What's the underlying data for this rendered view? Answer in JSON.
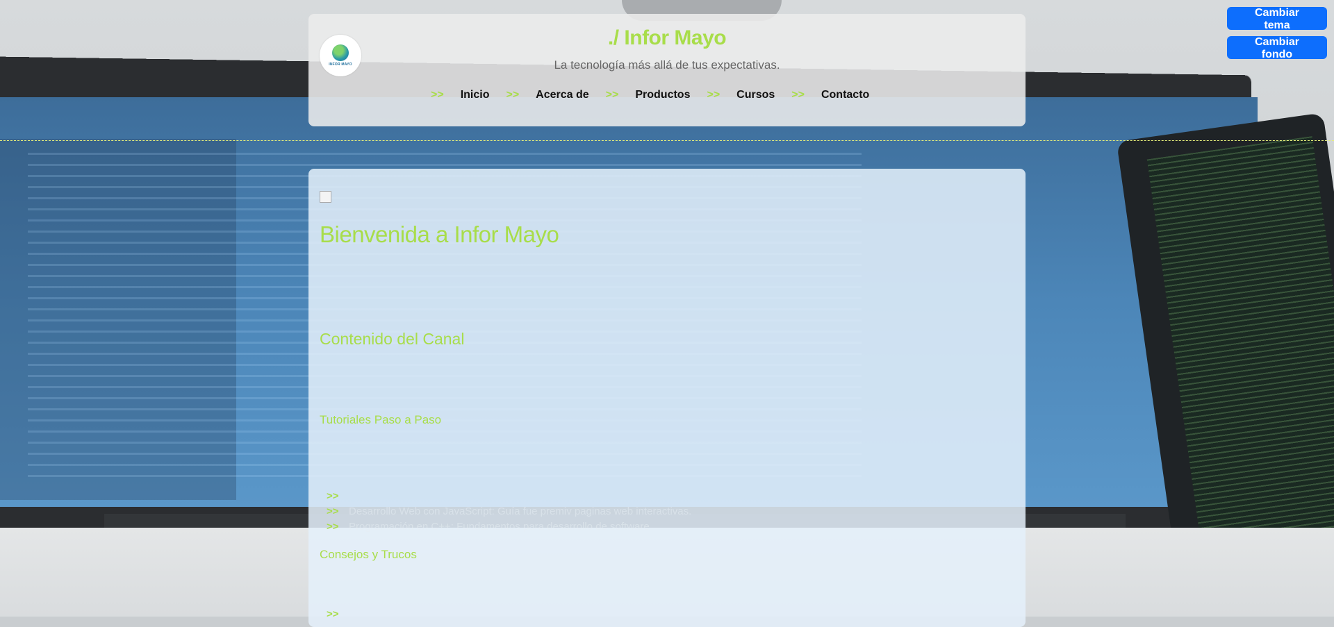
{
  "header": {
    "title": "./ Infor Mayo",
    "tagline": "La tecnología más allá de tus expectativas.",
    "logo": {
      "name": "INFOR MAYO"
    },
    "nav_separator": ">>",
    "nav": [
      {
        "label": "Inicio"
      },
      {
        "label": "Acerca de"
      },
      {
        "label": "Productos"
      },
      {
        "label": "Cursos"
      },
      {
        "label": "Contacto"
      }
    ]
  },
  "controls": {
    "theme_button": "Cambiar tema",
    "background_button": "Cambiar fondo"
  },
  "main": {
    "welcome_heading": "Bienvenida a Infor Mayo",
    "channel_heading": "Contenido del Canal",
    "tutorials_heading": "Tutoriales Paso a Paso",
    "tutorials": [
      {
        "arrow": ">>",
        "text": ""
      },
      {
        "arrow": ">>",
        "text": "Desarrollo Web con JavaScript: Guía fue premiv paginas web interactivas."
      },
      {
        "arrow": ">>",
        "text": "Programación en C++: Fundamentos para desarrollo de software"
      }
    ],
    "tips_heading": "Consejos y Trucos",
    "tips": [
      {
        "arrow": ">>",
        "text": ""
      }
    ]
  },
  "colors": {
    "accent": "#a8dd4a",
    "button": "#0d6efd",
    "nav_text": "#111111"
  }
}
